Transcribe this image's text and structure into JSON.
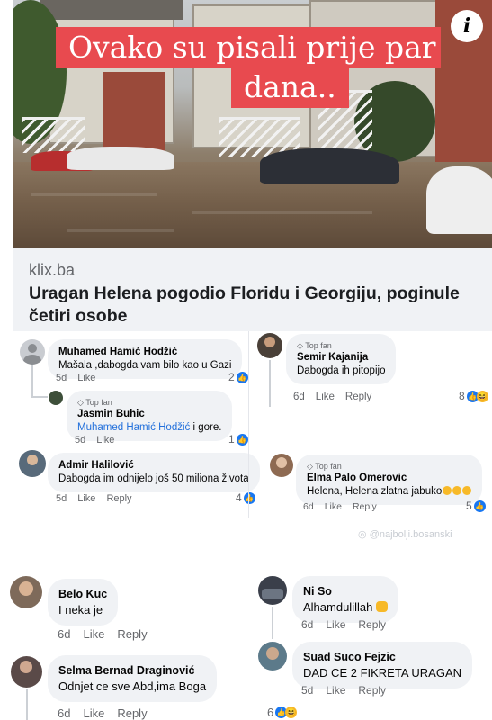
{
  "post": {
    "overlay_line1": "Ovako su pisali prije par",
    "overlay_line2": "dana..",
    "info_glyph": "i",
    "domain": "klix.ba",
    "headline": "Uragan Helena pogodio Floridu i Georgiju, poginule četiri osobe"
  },
  "labels": {
    "like": "Like",
    "reply": "Reply",
    "top_fan": "Top fan"
  },
  "colors": {
    "overlay_red": "#e84a4f",
    "fb_blue": "#1877f2",
    "mention_blue": "#216fdb",
    "bubble_bg": "#f0f2f5"
  },
  "icons": {
    "like": "like-icon",
    "haha": "haha-icon",
    "top_fan": "diamond-icon",
    "info": "info-icon"
  },
  "left_comments": [
    {
      "name": "Muhamed Hamić Hodžić",
      "text": "Mašala ,dabogda vam bilo kao u Gazi",
      "time": "5d",
      "reactions": "2"
    },
    {
      "name": "Jasmin Buhic",
      "mention": "Muhamed Hamić Hodžić",
      "text": " i gore.",
      "time": "5d",
      "reactions": "1"
    },
    {
      "name": "Admir Halilović",
      "text": "Dabogda im odnijelo još 50 miliona života",
      "time": "5d",
      "reactions": "4"
    }
  ],
  "right_comments": [
    {
      "name": "Semir Kajanija",
      "text": "Dabogda ih pitopijo",
      "time": "6d",
      "reactions": "8"
    },
    {
      "name": "Elma Palo Omerovic",
      "text": "Helena, Helena zlatna jabuko",
      "time": "6d",
      "reactions": "5"
    }
  ],
  "watermark": "@najbolji.bosanski",
  "bottom_left": [
    {
      "name": "Belo Kuc",
      "text": "I neka je",
      "time": "6d"
    },
    {
      "name": "Selma Bernad Draginović",
      "text": "Odnjet ce sve Abd,ima Boga",
      "time": "6d"
    }
  ],
  "bottom_right": [
    {
      "name": "Ni So",
      "text": "Alhamdulillah",
      "time": "6d"
    },
    {
      "name": "Suad Suco Fejzic",
      "text": "DAD CE 2 FIKRETA URAGAN",
      "time": "5d"
    }
  ],
  "bottom_reaction_count": "6"
}
